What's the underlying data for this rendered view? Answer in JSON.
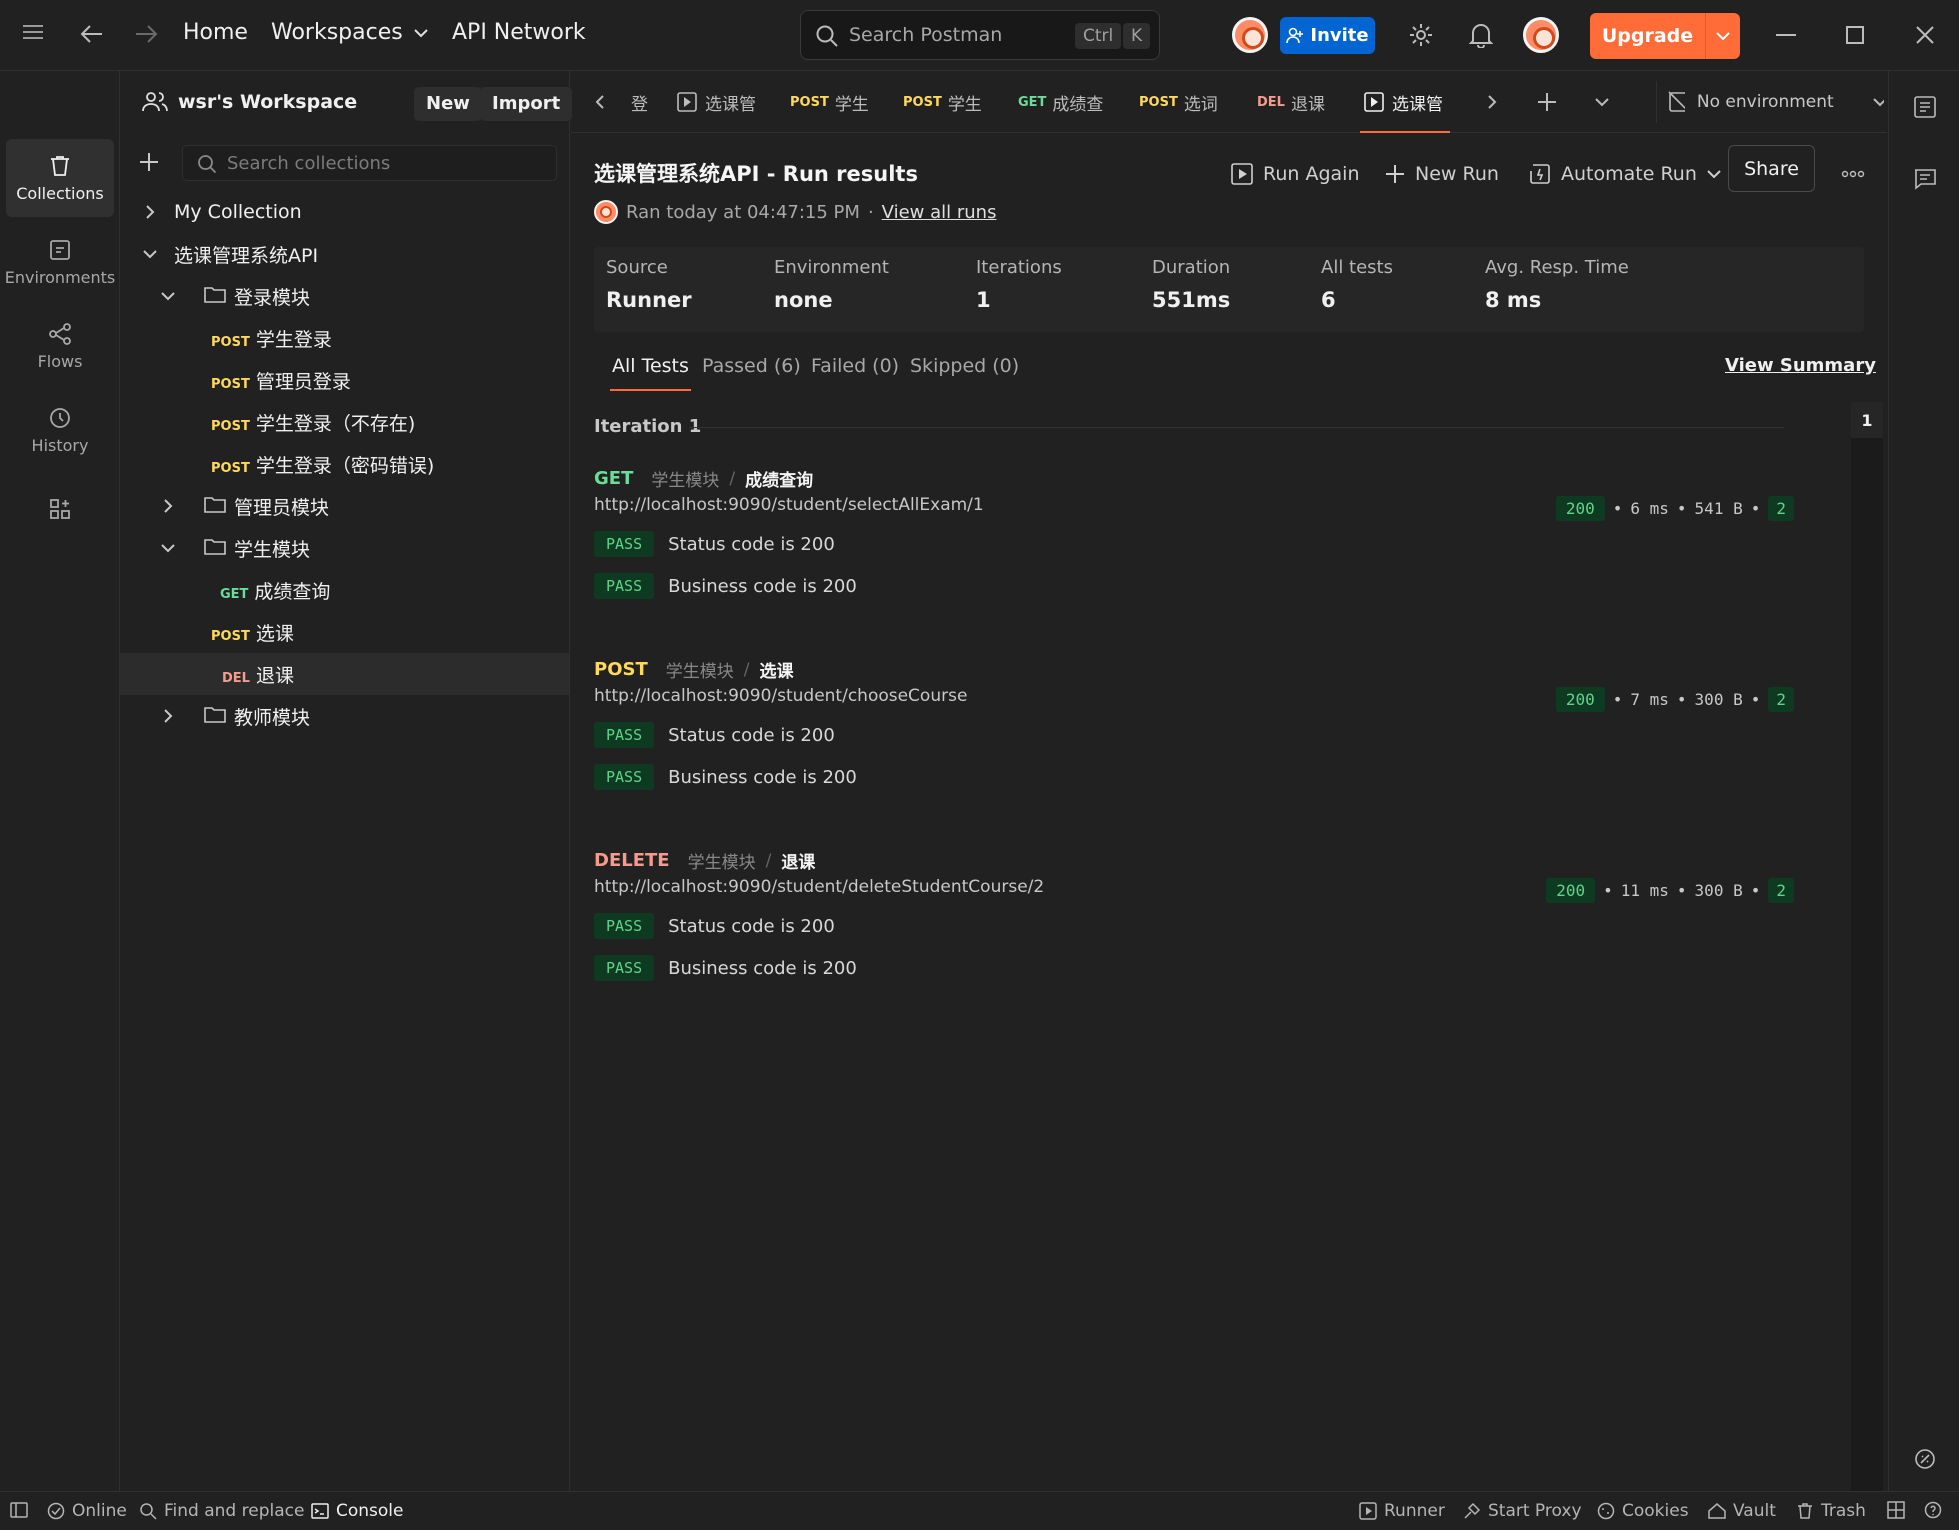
{
  "titlebar": {
    "home": "Home",
    "workspaces": "Workspaces",
    "api_network": "API Network",
    "search_placeholder": "Search Postman",
    "kbd_ctrl": "Ctrl",
    "kbd_k": "K",
    "invite": "Invite",
    "upgrade": "Upgrade"
  },
  "rail": {
    "collections": "Collections",
    "environments": "Environments",
    "flows": "Flows",
    "history": "History"
  },
  "sidebar": {
    "workspace_name": "wsr's Workspace",
    "new_label": "New",
    "import_label": "Import",
    "search_placeholder": "Search collections",
    "tree": [
      {
        "label": "My Collection"
      },
      {
        "label": "选课管理系统API"
      },
      {
        "label": "登录模块"
      },
      {
        "method": "POST",
        "label": "学生登录"
      },
      {
        "method": "POST",
        "label": "管理员登录"
      },
      {
        "method": "POST",
        "label": "学生登录（不存在)"
      },
      {
        "method": "POST",
        "label": "学生登录（密码错误)"
      },
      {
        "label": "管理员模块"
      },
      {
        "label": "学生模块"
      },
      {
        "method": "GET",
        "label": "成绩查询"
      },
      {
        "method": "POST",
        "label": "选课"
      },
      {
        "method": "DEL",
        "label": "退课"
      },
      {
        "label": "教师模块"
      }
    ]
  },
  "tabs": [
    {
      "method": "",
      "label": "登"
    },
    {
      "method": "",
      "label": "选课管"
    },
    {
      "method": "POST",
      "label": "学生"
    },
    {
      "method": "POST",
      "label": "学生"
    },
    {
      "method": "GET",
      "label": "成绩查"
    },
    {
      "method": "POST",
      "label": "选词"
    },
    {
      "method": "DEL",
      "label": "退课"
    },
    {
      "method": "",
      "label": "选课管"
    }
  ],
  "environment": "No environment",
  "run": {
    "title": "选课管理系统API - Run results",
    "run_again": "Run Again",
    "new_run": "New Run",
    "automate_run": "Automate Run",
    "share": "Share",
    "ran_text": "Ran today at 04:47:15 PM",
    "dot": "·",
    "view_all_runs": "View all runs",
    "stats": [
      {
        "k": "Source",
        "v": "Runner"
      },
      {
        "k": "Environment",
        "v": "none"
      },
      {
        "k": "Iterations",
        "v": "1"
      },
      {
        "k": "Duration",
        "v": "551ms"
      },
      {
        "k": "All tests",
        "v": "6"
      },
      {
        "k": "Avg. Resp. Time",
        "v": "8 ms"
      }
    ],
    "filters": {
      "all": "All Tests",
      "passed": "Passed (6)",
      "failed": "Failed (0)",
      "skipped": "Skipped (0)"
    },
    "view_summary": "View Summary",
    "iteration_label": "Iteration 1",
    "iteration_num": "1",
    "requests": [
      {
        "method": "GET",
        "folder": "学生模块",
        "sep": "/",
        "name": "成绩查询",
        "url": "http://localhost:9090/student/selectAllExam/1",
        "status": "200",
        "time": "6 ms",
        "size": "541 B",
        "count": "2",
        "tests": [
          {
            "result": "PASS",
            "name": "Status code is 200"
          },
          {
            "result": "PASS",
            "name": "Business code is 200"
          }
        ]
      },
      {
        "method": "POST",
        "folder": "学生模块",
        "sep": "/",
        "name": "选课",
        "url": "http://localhost:9090/student/chooseCourse",
        "status": "200",
        "time": "7 ms",
        "size": "300 B",
        "count": "2",
        "tests": [
          {
            "result": "PASS",
            "name": "Status code is 200"
          },
          {
            "result": "PASS",
            "name": "Business code is 200"
          }
        ]
      },
      {
        "method": "DELETE",
        "folder": "学生模块",
        "sep": "/",
        "name": "退课",
        "url": "http://localhost:9090/student/deleteStudentCourse/2",
        "status": "200",
        "time": "11 ms",
        "size": "300 B",
        "count": "2",
        "tests": [
          {
            "result": "PASS",
            "name": "Status code is 200"
          },
          {
            "result": "PASS",
            "name": "Business code is 200"
          }
        ]
      }
    ],
    "bullet": "•"
  },
  "statusbar": {
    "online": "Online",
    "find_replace": "Find and replace",
    "console": "Console",
    "runner": "Runner",
    "start_proxy": "Start Proxy",
    "cookies": "Cookies",
    "vault": "Vault",
    "trash": "Trash"
  },
  "colors": {
    "accent": "#ff6c37",
    "invite": "#0265d2",
    "post": "#ffd95a",
    "get": "#6bdd9a",
    "delete": "#f79a8e",
    "pass_bg": "#0e3a22",
    "pass_fg": "#5fd48a"
  }
}
